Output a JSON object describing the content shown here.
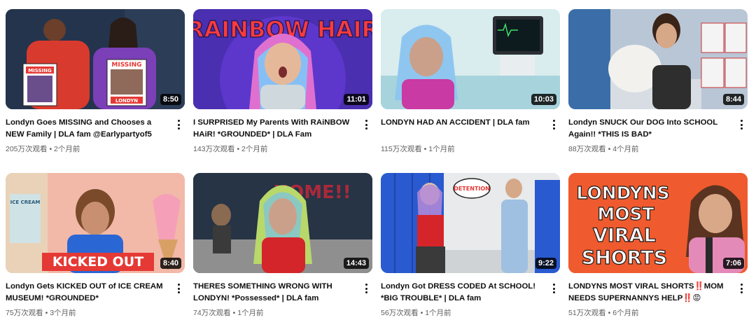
{
  "videos": [
    {
      "title": "Londyn Goes MISSING and Chooses a NEW Family | DLA fam @Earlypartyof5",
      "views": "205万次观看",
      "age": "2个月前",
      "duration": "8:50",
      "thumb_text": [
        "MISSING",
        "MISSING",
        "LONDYN"
      ]
    },
    {
      "title": "I SURPRISED My Parents With RAiNBOW HAiR! *GROUNDED* | DLA Fam",
      "views": "143万次观看",
      "age": "2个月前",
      "duration": "11:01",
      "thumb_text": [
        "RAINBOW HAIR"
      ]
    },
    {
      "title": "LONDYN HAD AN ACCIDENT | DLA fam",
      "views": "115万次观看",
      "age": "1个月前",
      "duration": "10:03",
      "thumb_text": []
    },
    {
      "title": "Londyn SNUCK Our DOG Into SCHOOL Again!! *THIS IS BAD*",
      "views": "88万次观看",
      "age": "4个月前",
      "duration": "8:44",
      "thumb_text": []
    },
    {
      "title": "Londyn Gets KICKED OUT of ICE CREAM MUSEUM! *GROUNDED*",
      "views": "75万次观看",
      "age": "3个月前",
      "duration": "8:40",
      "thumb_text": [
        "KICKED OUT",
        "ICE CREAM"
      ]
    },
    {
      "title": "THERES SOMETHING WRONG WITH LONDYN! *Possessed* | DLA fam",
      "views": "74万次观看",
      "age": "1个月前",
      "duration": "14:43",
      "thumb_text": [
        "HOME!!"
      ]
    },
    {
      "title": "Londyn Got DRESS CODED At SCHOOL! *BIG TROUBLE* | DLA fam",
      "views": "56万次观看",
      "age": "1个月前",
      "duration": "9:22",
      "thumb_text": [
        "DETENTION"
      ]
    },
    {
      "title": "LONDYNS MOST VIRAL SHORTS‼️MOM NEEDS SUPERNANNYS HELP‼️😡",
      "views": "51万次观看",
      "age": "6个月前",
      "duration": "7:06",
      "thumb_text": [
        "LONDYNS",
        "MOST",
        "VIRAL",
        "SHORTS"
      ]
    }
  ],
  "colors": {
    "title_text": "#0f0f0f",
    "meta_text": "#606060",
    "duration_bg": "#000000",
    "missing_red": "#e53935",
    "kicked_red": "#e53935",
    "shorts_orange": "#f26a3b"
  },
  "icons": {
    "menu": "more-vertical-icon"
  }
}
